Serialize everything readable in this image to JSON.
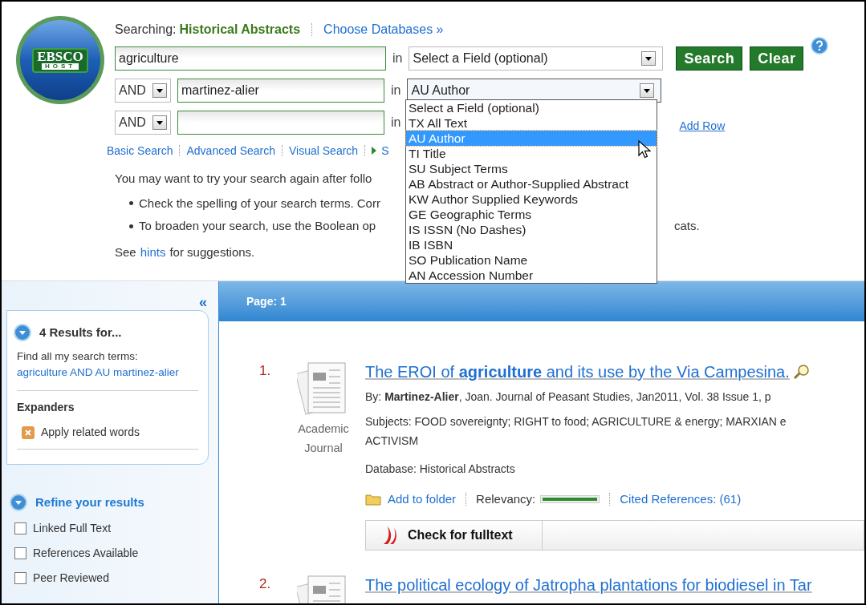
{
  "logo": {
    "text": "EBSCO",
    "subtext": "HOST"
  },
  "searching": {
    "label": "Searching:",
    "database": "Historical Abstracts",
    "choose_link": "Choose Databases »"
  },
  "search_rows": [
    {
      "value": "agriculture",
      "in_label": "in",
      "field": "Select a Field (optional)"
    },
    {
      "operator": "AND",
      "value": "martinez-alier",
      "in_label": "in",
      "field": "AU Author",
      "expanded": true
    },
    {
      "operator": "AND",
      "in_label": "in"
    }
  ],
  "buttons": [
    {
      "label": "Search"
    },
    {
      "label": "Clear"
    }
  ],
  "add_row": "Add Row",
  "dropdown": {
    "items": [
      {
        "label": "Select a Field (optional)",
        "selected": false
      },
      {
        "label": "TX All Text",
        "selected": false
      },
      {
        "label": "AU Author",
        "selected": true
      },
      {
        "label": "TI Title",
        "selected": false
      },
      {
        "label": "SU Subject Terms",
        "selected": false
      },
      {
        "label": "AB Abstract or Author-Supplied Abstract",
        "selected": false
      },
      {
        "label": "KW Author Supplied Keywords",
        "selected": false
      },
      {
        "label": "GE Geographic Terms",
        "selected": false
      },
      {
        "label": "IS ISSN (No Dashes)",
        "selected": false
      },
      {
        "label": "IB ISBN",
        "selected": false
      },
      {
        "label": "SO Publication Name",
        "selected": false
      },
      {
        "label": "AN Accession Number",
        "selected": false
      }
    ]
  },
  "mode_links": [
    {
      "label": "Basic Search",
      "kind": "plain"
    },
    {
      "label": "Advanced Search",
      "kind": "plain"
    },
    {
      "label": "Visual Search",
      "kind": "plain"
    },
    {
      "label": "S",
      "kind": "arrow"
    }
  ],
  "message": {
    "intro": "You may want to try your search again after follo",
    "bullets": [
      {
        "text": "Check the spelling of your search terms. Corr"
      },
      {
        "text": "To broaden your search, use the Boolean op",
        "tail": "cats."
      }
    ],
    "hint_before": "See",
    "hint_link": "hints",
    "hint_after": "for suggestions."
  },
  "sidebar": {
    "collapse": "«",
    "results_title": "4 Results for...",
    "find_label": "Find all my search terms:",
    "query": "agriculture AND AU martinez-alier",
    "expanders_title": "Expanders",
    "expanders": [
      {
        "label": "Apply related words"
      }
    ],
    "refine_title": "Refine your results",
    "filters": [
      {
        "label": "Linked Full Text",
        "checked": false
      },
      {
        "label": "References Available",
        "checked": false
      },
      {
        "label": "Peer Reviewed",
        "checked": false
      }
    ]
  },
  "results": {
    "page_label": "Page: 1",
    "items": [
      {
        "rank": "1.",
        "type_label": "Academic Journal",
        "title": "The EROI of **agriculture** and its use by the Via Campesina.",
        "byline": "By: **Martinez-Alier**, Joan. Journal of Peasant Studies, Jan2011, Vol. 38 Issue 1, p",
        "subjects": [
          "Subjects: FOOD sovereignty; RIGHT to food; AGRICULTURE & energy; MARXIAN e",
          "ACTIVISM"
        ],
        "database": "Database: Historical Abstracts",
        "add_folder": "Add to folder",
        "relevancy_label": "Relevancy:",
        "relevancy": {
          "level": 1
        },
        "cited": "Cited References: (61)",
        "fulltext": "Check for fulltext"
      },
      {
        "rank": "2.",
        "title": "The political ecology of Jatropha plantations for biodiesel in Tar"
      }
    ]
  }
}
